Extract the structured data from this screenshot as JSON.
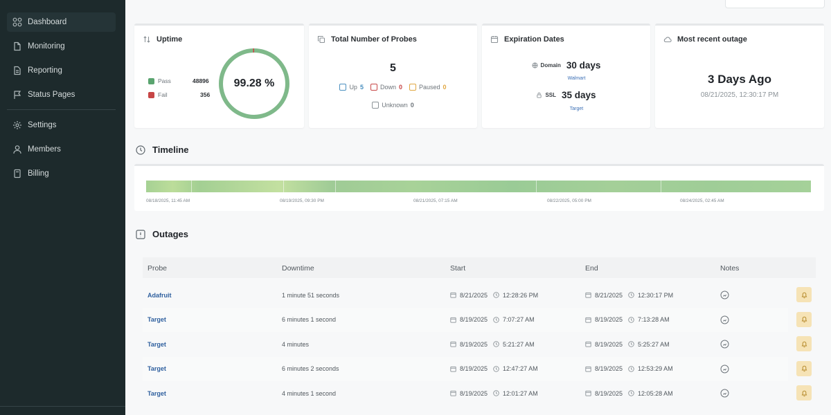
{
  "sidebar": {
    "items": [
      {
        "label": "Dashboard",
        "icon": "dashboard-icon",
        "active": true
      },
      {
        "label": "Monitoring",
        "icon": "monitoring-icon"
      },
      {
        "label": "Reporting",
        "icon": "reporting-icon"
      },
      {
        "label": "Status Pages",
        "icon": "flag-icon"
      },
      {
        "label": "Settings",
        "icon": "gear-icon"
      },
      {
        "label": "Members",
        "icon": "user-icon"
      },
      {
        "label": "Billing",
        "icon": "billing-icon"
      }
    ]
  },
  "cards": {
    "uptime": {
      "title": "Uptime",
      "pass_label": "Pass",
      "pass_value": "48896",
      "fail_label": "Fail",
      "fail_value": "356",
      "percent": "99.28 %",
      "pass_color": "#5aa46f",
      "fail_color": "#c74646",
      "ring_fraction": 0.9928
    },
    "probes": {
      "title": "Total Number of Probes",
      "total": "5",
      "up_label": "Up",
      "up_value": "5",
      "down_label": "Down",
      "down_value": "0",
      "paused_label": "Paused",
      "paused_value": "0",
      "unknown_label": "Unknown",
      "unknown_value": "0"
    },
    "expiration": {
      "title": "Expiration Dates",
      "domain_label": "Domain",
      "domain_value": "30 days",
      "domain_link": "Walmart",
      "ssl_label": "SSL",
      "ssl_value": "35 days",
      "ssl_link": "Target"
    },
    "outage": {
      "title": "Most recent outage",
      "ago": "3 Days Ago",
      "timestamp": "08/21/2025, 12:30:17 PM"
    }
  },
  "timeline": {
    "title": "Timeline",
    "labels": [
      "08/18/2025, 11:45 AM",
      "08/19/2025, 09:30 PM",
      "08/21/2025, 07:15 AM",
      "08/22/2025, 05:00 PM",
      "08/24/2025, 02:45 AM"
    ]
  },
  "outages": {
    "title": "Outages",
    "columns": {
      "probe": "Probe",
      "downtime": "Downtime",
      "start": "Start",
      "end": "End",
      "notes": "Notes"
    },
    "rows": [
      {
        "probe": "Adafruit",
        "downtime": "1 minute 51 seconds",
        "start_date": "8/21/2025",
        "start_time": "12:28:26 PM",
        "end_date": "8/21/2025",
        "end_time": "12:30:17 PM"
      },
      {
        "probe": "Target",
        "downtime": "6 minutes 1 second",
        "start_date": "8/19/2025",
        "start_time": "7:07:27 AM",
        "end_date": "8/19/2025",
        "end_time": "7:13:28 AM"
      },
      {
        "probe": "Target",
        "downtime": "4 minutes",
        "start_date": "8/19/2025",
        "start_time": "5:21:27 AM",
        "end_date": "8/19/2025",
        "end_time": "5:25:27 AM"
      },
      {
        "probe": "Target",
        "downtime": "6 minutes 2 seconds",
        "start_date": "8/19/2025",
        "start_time": "12:47:27 AM",
        "end_date": "8/19/2025",
        "end_time": "12:53:29 AM"
      },
      {
        "probe": "Target",
        "downtime": "4 minutes 1 second",
        "start_date": "8/19/2025",
        "start_time": "12:01:27 AM",
        "end_date": "8/19/2025",
        "end_time": "12:05:28 AM"
      }
    ]
  }
}
